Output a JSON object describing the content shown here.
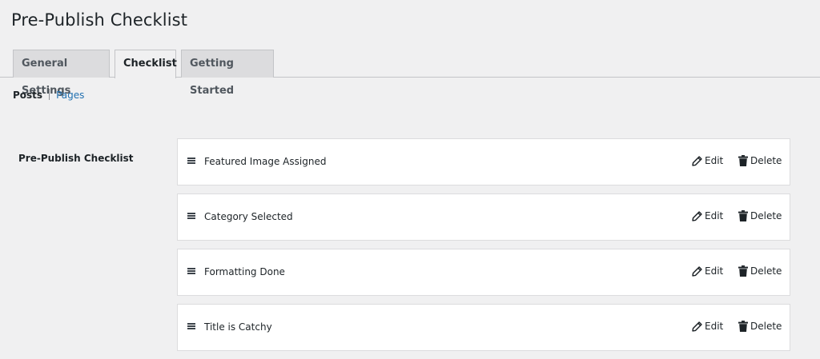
{
  "page": {
    "title": "Pre-Publish Checklist"
  },
  "tabs": [
    {
      "label": "General Settings",
      "active": false
    },
    {
      "label": "Checklist",
      "active": true
    },
    {
      "label": "Getting Started",
      "active": false
    }
  ],
  "subnav": {
    "current": "Posts",
    "other": "Pages"
  },
  "section": {
    "label": "Pre-Publish Checklist"
  },
  "checklist": {
    "items": [
      {
        "label": "Featured Image Assigned"
      },
      {
        "label": "Category Selected"
      },
      {
        "label": "Formatting Done"
      },
      {
        "label": "Title is Catchy"
      }
    ],
    "edit_label": "Edit",
    "delete_label": "Delete"
  },
  "icons": {
    "drag": "hamburger-icon",
    "edit": "pencil-icon",
    "delete": "trash-icon"
  },
  "colors": {
    "background": "#f0f0f1",
    "link": "#2271b1",
    "tab_inactive": "#dcdcde"
  }
}
